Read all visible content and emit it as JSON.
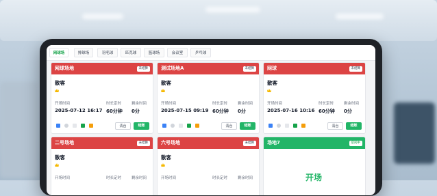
{
  "tabs": [
    "网球场",
    "排球场",
    "羽毛球",
    "匹克球",
    "篮球场",
    "会议室",
    "乒乓球"
  ],
  "labels": {
    "start": "开场时间",
    "duration": "时长定时",
    "remaining": "剩余时间",
    "settle_btn": "清台",
    "checkout_btn": "结账"
  },
  "cards": [
    {
      "title": "网球场地",
      "status": "未结算",
      "customer": "散客",
      "start": "2025-07-12 16:17",
      "duration": "60分钟",
      "remaining": "0分"
    },
    {
      "title": "测试场地A",
      "status": "未结算",
      "customer": "散客",
      "start": "2025-07-15 09:19",
      "duration": "60分钟",
      "remaining": "0分"
    },
    {
      "title": "网球",
      "status": "未结算",
      "customer": "散客",
      "start": "2025-07-16 10:16",
      "duration": "60分钟",
      "remaining": "0分"
    },
    {
      "title": "二号场地",
      "status": "未结算",
      "customer": "散客"
    },
    {
      "title": "六号场地",
      "status": "未结算",
      "customer": "散客"
    },
    {
      "title": "场地7",
      "status": "空闲中",
      "open_text": "开场"
    }
  ],
  "colors": {
    "occupied": "#dc4444",
    "free": "#22b567",
    "accent": "#16a34a"
  }
}
